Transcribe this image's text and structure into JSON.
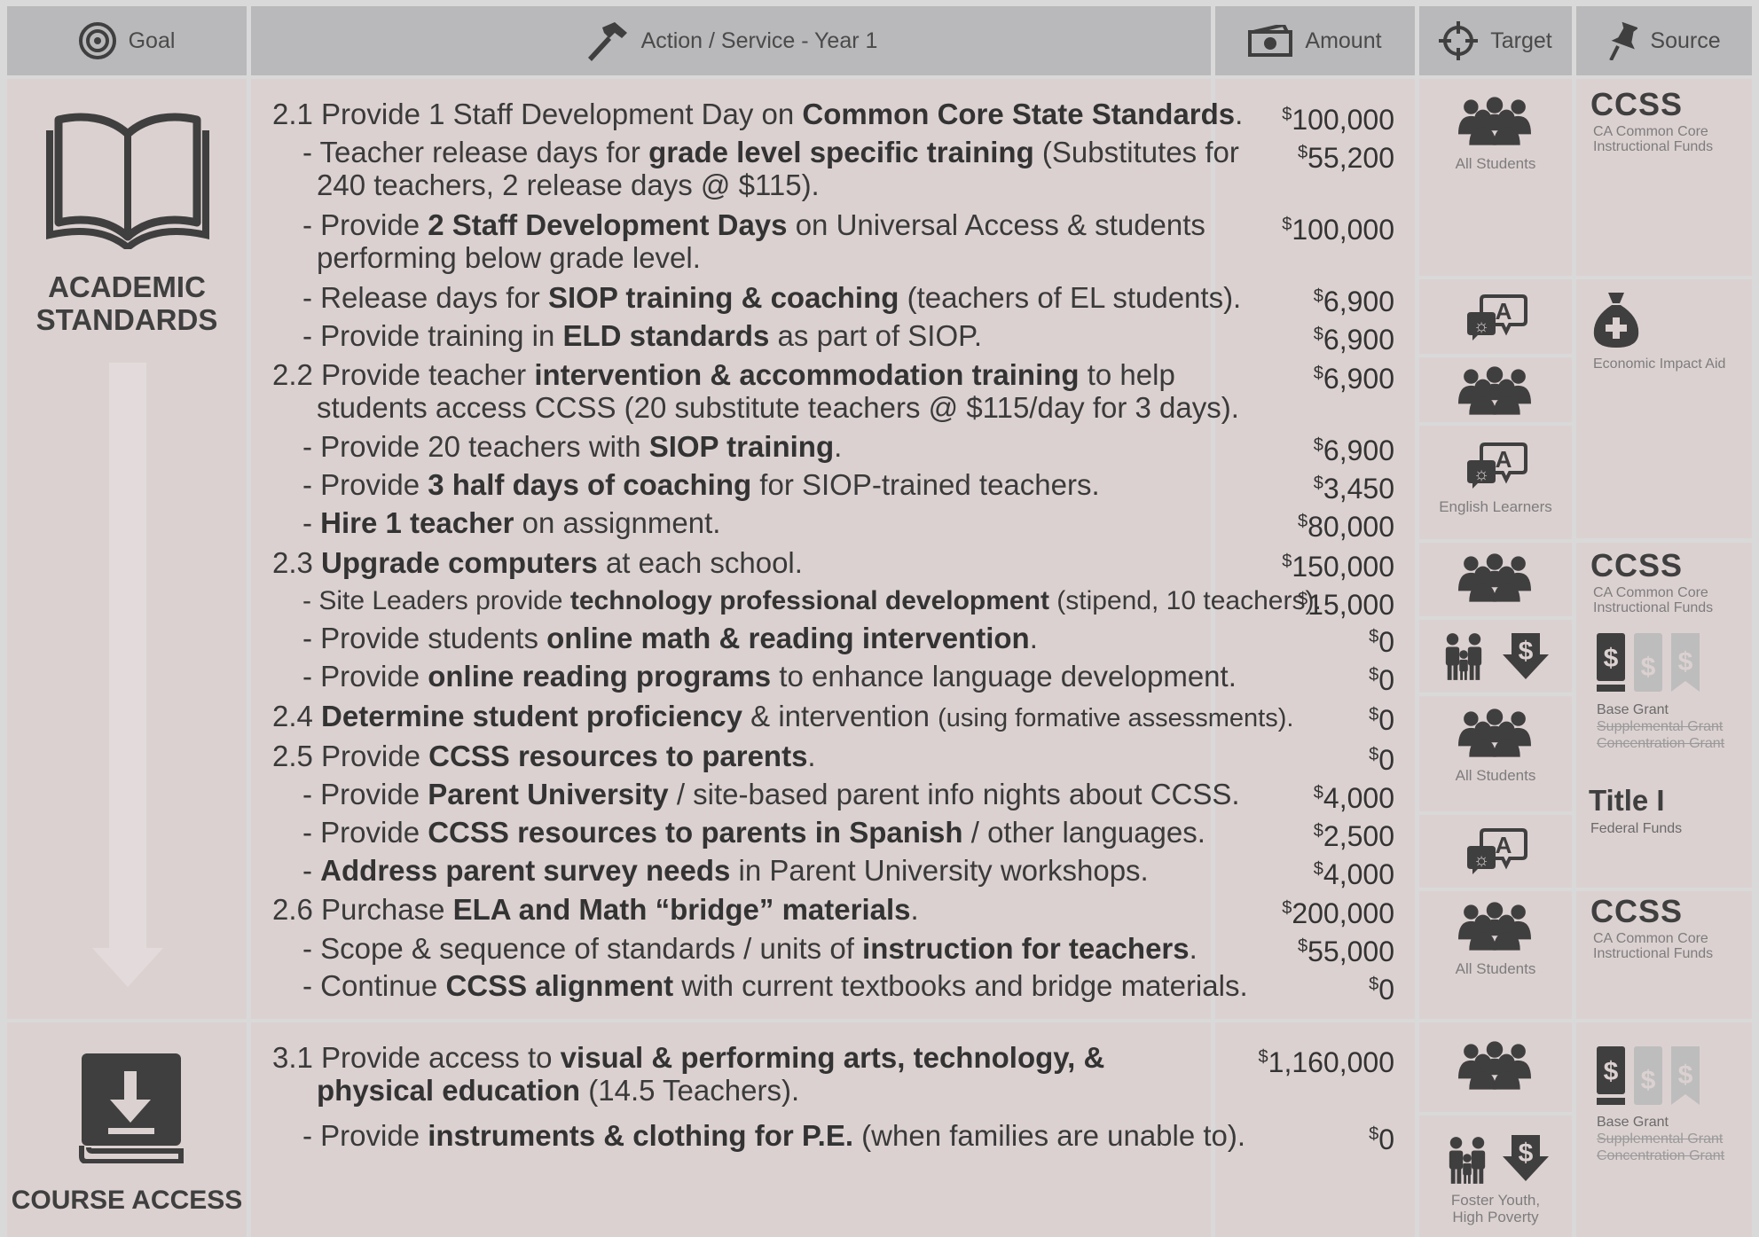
{
  "header": {
    "goal": "Goal",
    "action": "Action / Service - Year 1",
    "amount": "Amount",
    "target": "Target",
    "source": "Source"
  },
  "goals": {
    "academic": "ACADEMIC\nSTANDARDS",
    "course": "COURSE ACCESS"
  },
  "target_labels": {
    "all_students": "All Students",
    "english_learners": "English Learners",
    "foster_poverty": "Foster Youth,\nHigh Poverty"
  },
  "sources": {
    "ccss_logo": "CCSS",
    "ccss_sub": "CA Common Core\nInstructional Funds",
    "eia": "Economic Impact Aid",
    "base": "Base Grant",
    "supplemental": "Supplemental Grant",
    "concentration": "Concentration Grant",
    "title1": "Title I",
    "federal": "Federal Funds"
  },
  "amounts": [
    "100,000",
    "55,200",
    "100,000",
    "6,900",
    "6,900",
    "6,900",
    "6,900",
    "3,450",
    "80,000",
    "150,000",
    "15,000",
    "0",
    "0",
    "0",
    "0",
    "4,000",
    "2,500",
    "4,000",
    "200,000",
    "55,000",
    "0",
    "1,160,000",
    "0"
  ],
  "items": {
    "i21": [
      "2.1 Provide 1 Staff Development Day on ",
      "Common Core State Standards",
      "."
    ],
    "i21a": [
      "- Teacher release days for ",
      "grade level specific training",
      " (Substitutes for"
    ],
    "i21a2": "240 teachers, 2 release days @ $115).",
    "i21b": [
      "- Provide ",
      "2 Staff Development Days",
      " on Universal Access & students"
    ],
    "i21b2": "performing below grade level.",
    "i21c": [
      "- Release days for ",
      "SIOP training & coaching",
      " (teachers of EL students)."
    ],
    "i21d": [
      "- Provide training in ",
      "ELD standards",
      " as part of SIOP."
    ],
    "i22": [
      "2.2 Provide teacher ",
      "intervention & accommodation training",
      " to help"
    ],
    "i22b": "students access CCSS (20 substitute teachers @ $115/day for 3 days).",
    "i22c": [
      "- Provide 20 teachers with ",
      "SIOP training",
      "."
    ],
    "i22d": [
      "- Provide ",
      "3 half days of coaching",
      " for SIOP-trained teachers."
    ],
    "i22e": [
      "- ",
      "Hire 1 teacher",
      " on assignment."
    ],
    "i23": [
      "2.3 ",
      "Upgrade computers",
      " at each school."
    ],
    "i23a": [
      "- Site Leaders provide ",
      "technology professional development",
      " (stipend, 10 teachers)."
    ],
    "i23b": [
      "- Provide students ",
      "online math & reading intervention",
      "."
    ],
    "i23c": [
      "- Provide ",
      "online reading programs",
      " to enhance language development."
    ],
    "i24": [
      "2.4 ",
      "Determine student proficiency",
      " & intervention ",
      "(using formative assessments)."
    ],
    "i25": [
      "2.5 Provide ",
      "CCSS resources to parents",
      "."
    ],
    "i25a": [
      "- Provide ",
      "Parent University",
      " / site-based parent info nights about CCSS."
    ],
    "i25b": [
      "- Provide ",
      "CCSS resources to parents in Spanish",
      " / other languages."
    ],
    "i25c": [
      "- ",
      "Address parent survey needs",
      " in Parent University workshops."
    ],
    "i26": [
      "2.6 Purchase ",
      "ELA and Math “bridge” materials",
      "."
    ],
    "i26a": [
      "- Scope & sequence of standards / units of ",
      "instruction for teachers",
      "."
    ],
    "i26b": [
      "- Continue ",
      "CCSS alignment",
      " with current textbooks and bridge materials."
    ],
    "i31": [
      "3.1 Provide access to ",
      "visual & performing arts, technology, &"
    ],
    "i31b": [
      "physical education",
      " (14.5 Teachers)."
    ],
    "i31c": [
      "- Provide ",
      "instruments & clothing for P.E.",
      " (when families are unable to)."
    ]
  },
  "icons": {
    "goal_header": "target-icon",
    "action_header": "hammer-icon",
    "amount_header": "money-icon",
    "target_header": "crosshair-icon",
    "source_header": "pushpin-icon",
    "academic": "open-book-icon",
    "course": "download-book-icon",
    "all_students": "group-icon",
    "english_learners": "translation-icon",
    "foster": "family-icon",
    "poverty": "dollar-down-icon",
    "eia": "money-bag-icon",
    "grants": "dollar-grant-icons"
  }
}
